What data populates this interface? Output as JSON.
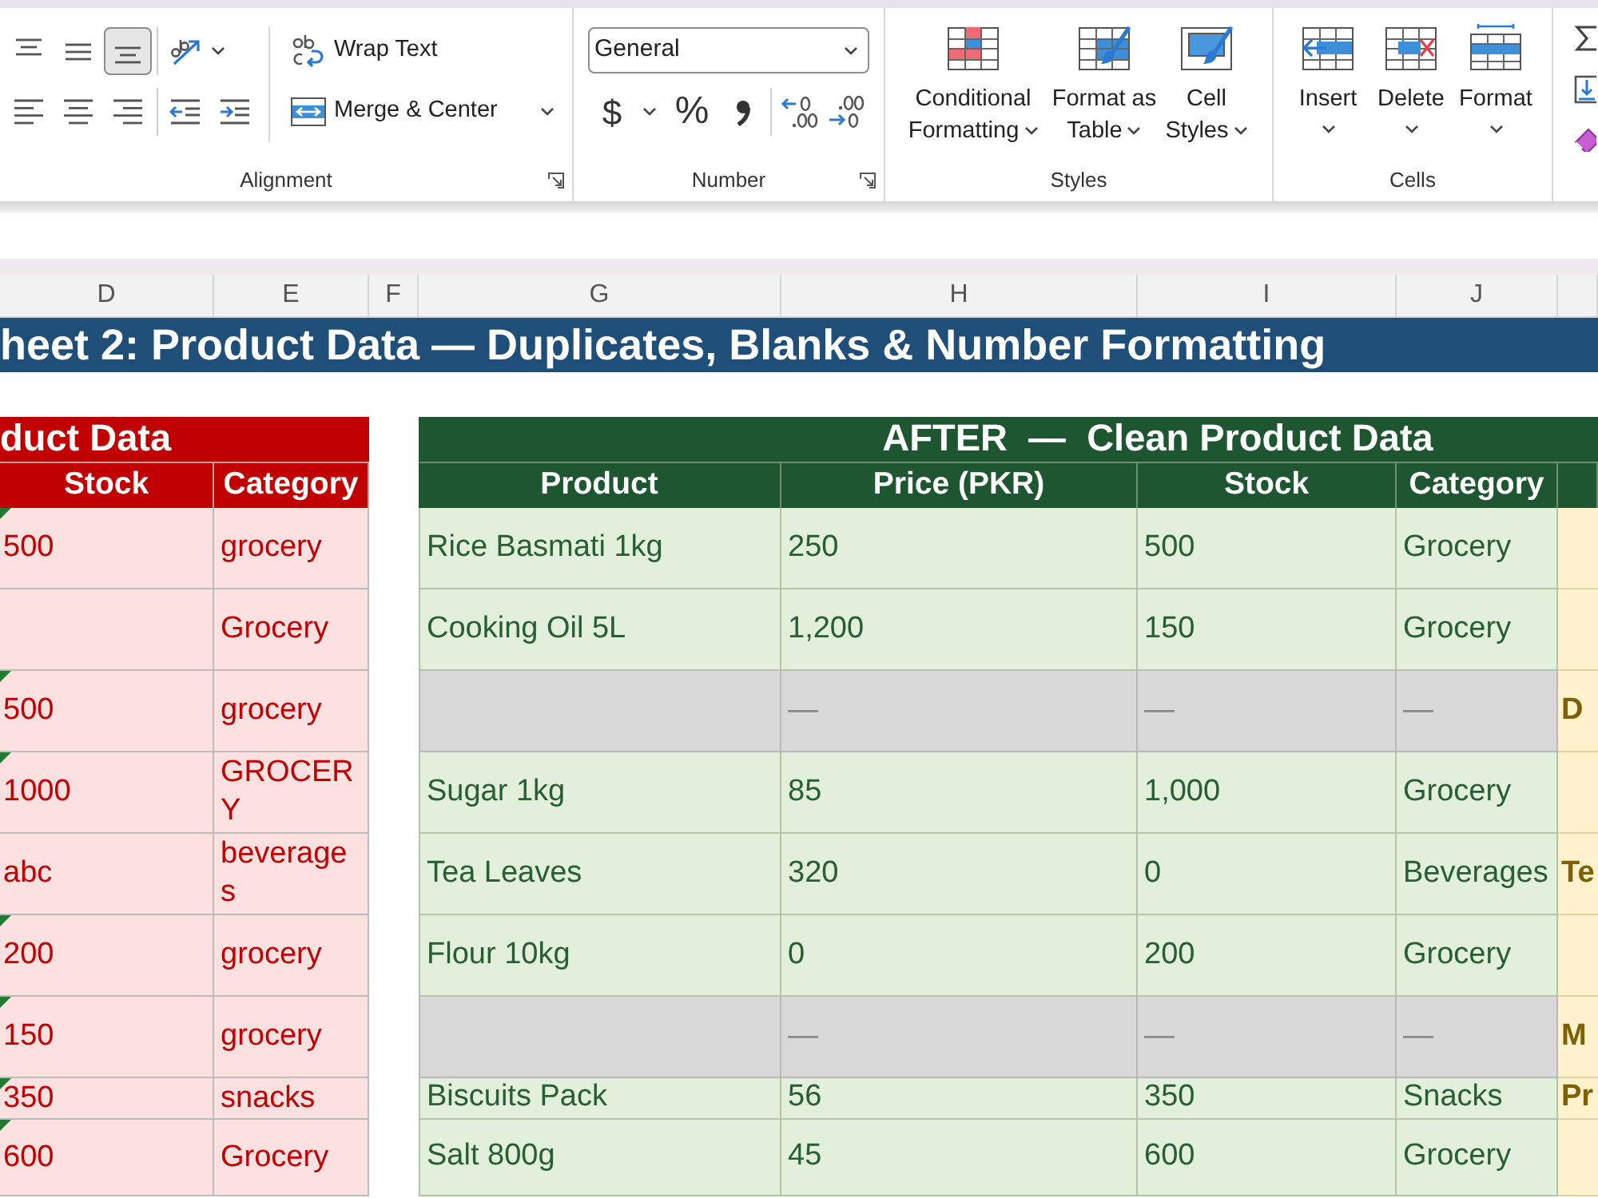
{
  "ribbon": {
    "alignment": {
      "label": "Alignment",
      "vertical": [
        {
          "kind": "top",
          "selected": false
        },
        {
          "kind": "middle",
          "selected": false
        },
        {
          "kind": "bottom",
          "selected": true
        }
      ],
      "horizontal": [
        {
          "kind": "left",
          "selected": false
        },
        {
          "kind": "center",
          "selected": false
        },
        {
          "kind": "right",
          "selected": false
        }
      ],
      "wrap_text": "Wrap Text",
      "merge": "Merge & Center"
    },
    "number": {
      "label": "Number",
      "format": "General",
      "currency": "$",
      "percent": "%"
    },
    "styles": {
      "label": "Styles",
      "buttons": [
        {
          "kind": "conditional",
          "label": "Conditional Formatting"
        },
        {
          "kind": "table",
          "label": "Format as Table"
        },
        {
          "kind": "cell_styles",
          "label": "Cell Styles"
        }
      ]
    },
    "cells": {
      "label": "Cells",
      "buttons": [
        {
          "kind": "insert",
          "label": "Insert"
        },
        {
          "kind": "delete",
          "label": "Delete"
        },
        {
          "kind": "format",
          "label": "Format"
        }
      ]
    }
  },
  "sheet": {
    "columns": [
      "D",
      "E",
      "F",
      "G",
      "H",
      "I",
      "J"
    ],
    "title": "heet 2: Product Data — Duplicates, Blanks & Number Formatting",
    "before": {
      "title": "duct Data",
      "headings": [
        "Stock",
        "Category"
      ],
      "rows": [
        {
          "stock": "500",
          "category": "grocery",
          "warning": true
        },
        {
          "category": "Grocery",
          "warning": false
        },
        {
          "stock": "500",
          "category": "grocery",
          "warning": true
        },
        {
          "stock": "1000",
          "category": "GROCERY",
          "warning": true
        },
        {
          "stock": "abc",
          "category": "beverages",
          "warning": false
        },
        {
          "stock": "200",
          "category": "grocery",
          "warning": true
        },
        {
          "stock": "150",
          "category": "grocery",
          "warning": true
        },
        {
          "stock": "350",
          "category": "snacks",
          "warning": true
        },
        {
          "stock": "600",
          "category": "Grocery",
          "warning": true
        }
      ]
    },
    "after": {
      "title": "AFTER  —  Clean Product Data",
      "headings": [
        "Product",
        "Price (PKR)",
        "Stock",
        "Category"
      ],
      "rows": [
        {
          "kind": "data",
          "product": "Rice Basmati 1kg",
          "price": "250",
          "stock": "500",
          "category": "Grocery"
        },
        {
          "kind": "data",
          "product": "Cooking Oil 5L",
          "price": "1,200",
          "stock": "150",
          "category": "Grocery"
        },
        {
          "kind": "blank",
          "price": "—",
          "stock": "—",
          "category": "—",
          "note": "D"
        },
        {
          "kind": "data",
          "product": "Sugar 1kg",
          "price": "85",
          "stock": "1,000",
          "category": "Grocery"
        },
        {
          "kind": "data",
          "product": "Tea Leaves",
          "price": "320",
          "stock": "0",
          "category": "Beverages",
          "note": "Te"
        },
        {
          "kind": "data",
          "product": "Flour 10kg",
          "price": "0",
          "stock": "200",
          "category": "Grocery"
        },
        {
          "kind": "blank",
          "price": "—",
          "stock": "—",
          "category": "—",
          "note": "M"
        },
        {
          "kind": "data",
          "product": "Biscuits Pack",
          "price": "56",
          "stock": "350",
          "category": "Snacks",
          "note": "Pr"
        },
        {
          "kind": "data",
          "product": "Salt 800g",
          "price": "45",
          "stock": "600",
          "category": "Grocery"
        }
      ]
    }
  }
}
